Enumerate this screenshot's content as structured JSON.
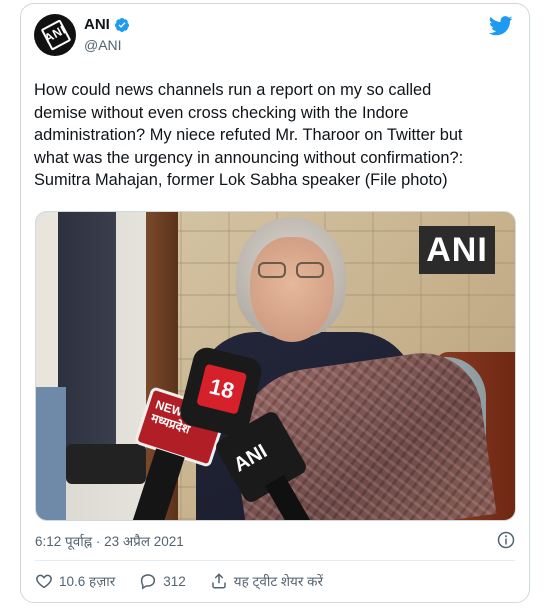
{
  "account": {
    "display_name": "ANI",
    "handle": "@ANI",
    "avatar_text": "ANI"
  },
  "tweet": {
    "text": "How could news channels run a report on my so called\ndemise without even cross checking with the Indore\nadministration? My niece refuted Mr. Tharoor on Twitter but\nwhat was the urgency in announcing without confirmation?:\nSumitra Mahajan, former Lok Sabha speaker (File photo)",
    "timestamp": "6:12 पूर्वाह्न · 23 अप्रैल 2021"
  },
  "photo": {
    "watermark": "ANI",
    "mic_18_label": "18",
    "mic_news_label": "NEWS 18\nमध्यप्रदेश",
    "mic_ani_label": "ANI"
  },
  "actions": {
    "likes": "10.6 हज़ार",
    "replies": "312",
    "share_label": "यह ट्वीट शेयर करें"
  },
  "icons": {
    "verified": "verified-badge-icon",
    "brand": "twitter-bird-icon",
    "info": "info-icon",
    "like": "heart-icon",
    "reply": "reply-bubble-icon",
    "share": "share-icon"
  },
  "colors": {
    "twitter_blue": "#1d9bf0",
    "secondary_text": "#536471",
    "border": "#cfd9de"
  }
}
